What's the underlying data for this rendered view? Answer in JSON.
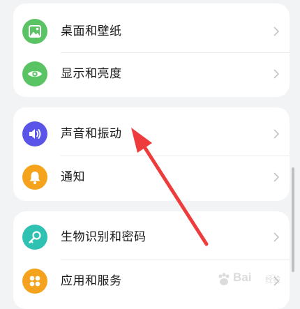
{
  "colors": {
    "background": "#f1f3f5",
    "card": "#ffffff",
    "icon_green": "#5ac465",
    "icon_purple": "#5b54e9",
    "icon_orange": "#f5a21c",
    "icon_teal": "#2fc1b2",
    "annotation_arrow": "#ee3b3b"
  },
  "settings": {
    "group1": [
      {
        "label": "桌面和壁纸",
        "icon": "wallpaper-icon"
      },
      {
        "label": "显示和亮度",
        "icon": "eye-icon"
      }
    ],
    "group2": [
      {
        "label": "声音和振动",
        "icon": "speaker-icon"
      },
      {
        "label": "通知",
        "icon": "bell-icon"
      }
    ],
    "group3": [
      {
        "label": "生物识别和密码",
        "icon": "key-icon"
      },
      {
        "label": "应用和服务",
        "icon": "apps-grid-icon"
      }
    ]
  },
  "watermark": {
    "text": "Bai",
    "sub": "经验"
  }
}
